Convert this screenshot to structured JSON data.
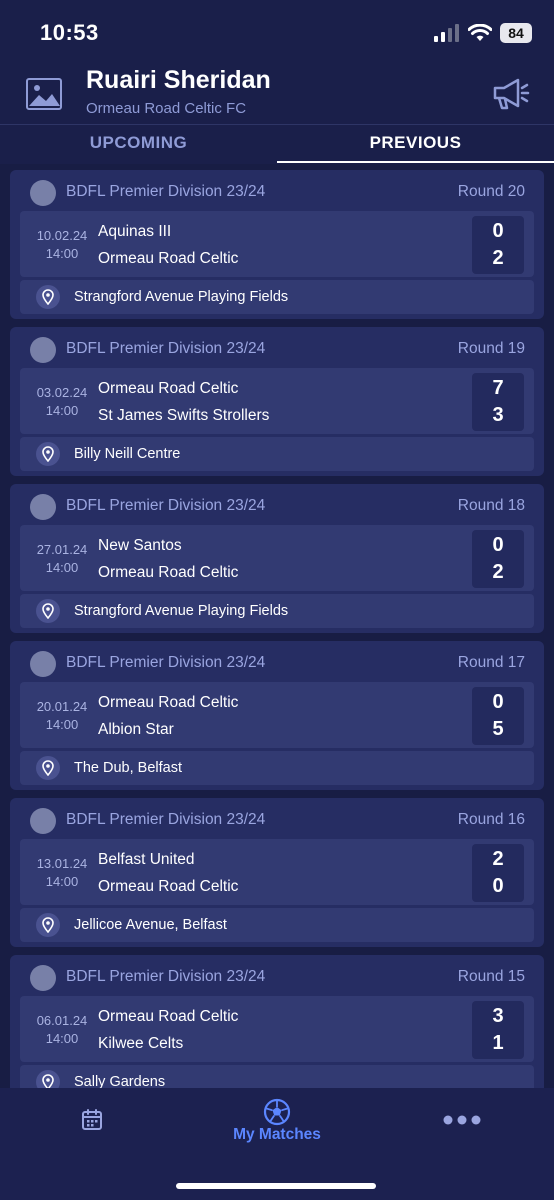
{
  "status_bar": {
    "time": "10:53",
    "battery": "84"
  },
  "header": {
    "name": "Ruairi Sheridan",
    "club": "Ormeau Road Celtic FC"
  },
  "tabs": {
    "upcoming": "UPCOMING",
    "previous": "PREVIOUS",
    "active": "PREVIOUS"
  },
  "matches": [
    {
      "league": "BDFL Premier Division 23/24",
      "round": "Round 20",
      "date": "10.02.24",
      "time": "14:00",
      "home": "Aquinas III",
      "away": "Ormeau Road Celtic",
      "home_score": "0",
      "away_score": "2",
      "venue": "Strangford Avenue Playing Fields"
    },
    {
      "league": "BDFL Premier Division 23/24",
      "round": "Round 19",
      "date": "03.02.24",
      "time": "14:00",
      "home": "Ormeau Road Celtic",
      "away": "St James Swifts Strollers",
      "home_score": "7",
      "away_score": "3",
      "venue": "Billy Neill Centre"
    },
    {
      "league": "BDFL Premier Division 23/24",
      "round": "Round 18",
      "date": "27.01.24",
      "time": "14:00",
      "home": "New Santos",
      "away": "Ormeau Road Celtic",
      "home_score": "0",
      "away_score": "2",
      "venue": "Strangford Avenue Playing Fields"
    },
    {
      "league": "BDFL Premier Division 23/24",
      "round": "Round 17",
      "date": "20.01.24",
      "time": "14:00",
      "home": "Ormeau Road Celtic",
      "away": "Albion Star",
      "home_score": "0",
      "away_score": "5",
      "venue": "The Dub, Belfast"
    },
    {
      "league": "BDFL Premier Division 23/24",
      "round": "Round 16",
      "date": "13.01.24",
      "time": "14:00",
      "home": "Belfast United",
      "away": "Ormeau Road Celtic",
      "home_score": "2",
      "away_score": "0",
      "venue": "Jellicoe Avenue, Belfast"
    },
    {
      "league": "BDFL Premier Division 23/24",
      "round": "Round 15",
      "date": "06.01.24",
      "time": "14:00",
      "home": "Ormeau Road Celtic",
      "away": "Kilwee Celts",
      "home_score": "3",
      "away_score": "1",
      "venue": "Sally Gardens"
    }
  ],
  "bottom_nav": {
    "matches_label": "My Matches"
  },
  "icons": {
    "avatar": "image-placeholder-icon",
    "announce": "megaphone-icon",
    "venue": "location-pin-icon",
    "calendar": "calendar-icon",
    "matches": "football-icon",
    "more": "more-dots-icon"
  },
  "colors": {
    "background": "#1a1f4a",
    "card": "#262d63",
    "accent": "#5b86ff",
    "muted": "#9aa5e0"
  }
}
